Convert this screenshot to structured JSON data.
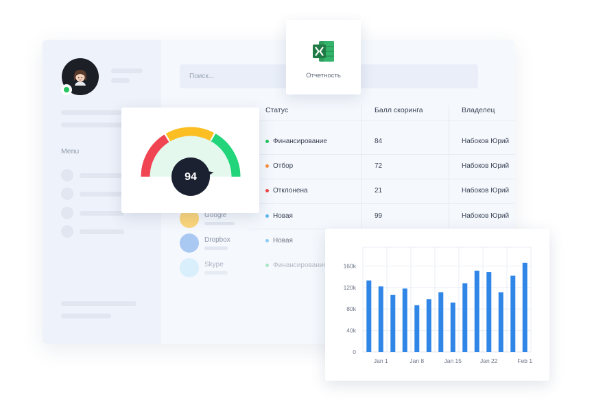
{
  "search": {
    "placeholder": "Поиск..."
  },
  "sidebar": {
    "menu_label": "Menu"
  },
  "table": {
    "headers": {
      "status": "Статус",
      "score": "Балл скоринга",
      "owner": "Владелец"
    },
    "rows": [
      {
        "status": "Финансирование",
        "status_color": "#22c55e",
        "score": "84",
        "owner": "Набоков Юрий"
      },
      {
        "status": "Отбор",
        "status_color": "#f5913d",
        "score": "72",
        "owner": "Набоков Юрий"
      },
      {
        "status": "Отклонена",
        "status_color": "#ef4444",
        "score": "21",
        "owner": "Набоков Юрий"
      },
      {
        "status": "Новая",
        "status_color": "#60b8f0",
        "score": "99",
        "owner": "Набоков Юрий"
      },
      {
        "status": "Новая",
        "status_color": "#60b8f0",
        "score": "",
        "owner": ""
      },
      {
        "status": "Финансирование",
        "status_color": "#22c55e",
        "score": "",
        "owner": ""
      }
    ],
    "companies": [
      {
        "name": "Google",
        "color": "#fbd57a"
      },
      {
        "name": "Dropbox",
        "color": "#a9c8f2"
      },
      {
        "name": "Skype",
        "color": "#cdebfb"
      }
    ]
  },
  "excel_card": {
    "label": "Отчетность",
    "icon": "excel-icon",
    "accent": "#1f7a45"
  },
  "gauge": {
    "value": "94",
    "value_fraction": 0.94,
    "zone_colors": [
      "#f04452",
      "#fbbf24",
      "#22d47a"
    ]
  },
  "chart_data": {
    "type": "bar",
    "values": [
      133,
      122,
      106,
      118,
      87,
      98,
      111,
      92,
      128,
      151,
      149,
      111,
      142,
      166
    ],
    "xticks": [
      {
        "index": 1,
        "label": "Jan 1"
      },
      {
        "index": 4,
        "label": "Jan 8"
      },
      {
        "index": 7,
        "label": "Jan 15"
      },
      {
        "index": 10,
        "label": "Jan 22"
      },
      {
        "index": 13,
        "label": "Feb 1"
      }
    ],
    "yticks": [
      {
        "value": 0,
        "label": "0"
      },
      {
        "value": 40,
        "label": "40k"
      },
      {
        "value": 80,
        "label": "80k"
      },
      {
        "value": 120,
        "label": "120k"
      },
      {
        "value": 160,
        "label": "160k"
      }
    ],
    "ylim": [
      0,
      195
    ],
    "grid": true,
    "color": "#2f86e6"
  }
}
